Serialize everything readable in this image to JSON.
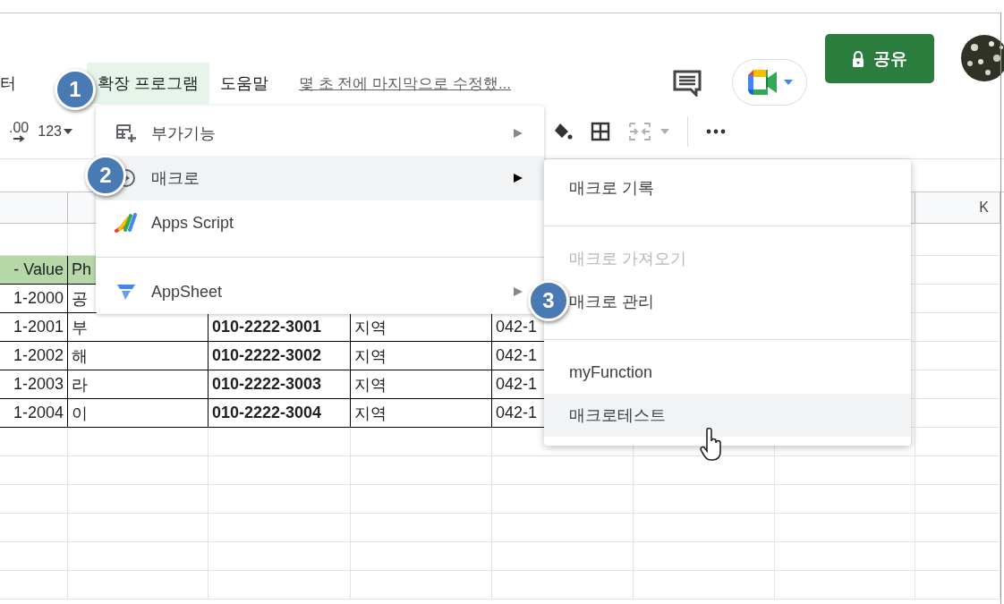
{
  "menubar": {
    "items": [
      {
        "label": "터",
        "selected": false
      },
      {
        "label": "확장 프로그램",
        "selected": true
      },
      {
        "label": "도움말",
        "selected": false
      }
    ],
    "last_edit": "몇 초 전에 마지막으로 수정했..."
  },
  "share_button": "공유",
  "toolbar": {
    "decimal": ".00",
    "format": "123",
    "merge_disabled": true
  },
  "sheet": {
    "column_header": "K",
    "header": [
      "- Value",
      "Ph"
    ],
    "rows": [
      {
        "cells": [
          "1-2000",
          "공",
          null,
          null,
          null
        ]
      },
      {
        "cells": [
          "1-2001",
          "부",
          "010-2222-3001",
          "지역",
          "042-1"
        ]
      },
      {
        "cells": [
          "1-2002",
          "해",
          "010-2222-3002",
          "지역",
          "042-1"
        ]
      },
      {
        "cells": [
          "1-2003",
          "라",
          "010-2222-3003",
          "지역",
          "042-1"
        ]
      },
      {
        "cells": [
          "1-2004",
          "이",
          "010-2222-3004",
          "지역",
          "042-1"
        ]
      }
    ]
  },
  "menu": {
    "items": [
      {
        "kind": "addon",
        "label": "부가기능",
        "selected": false,
        "submenu": true
      },
      {
        "kind": "macro",
        "label": "매크로",
        "selected": true,
        "submenu": true
      },
      {
        "kind": "script",
        "label": "Apps Script",
        "selected": false,
        "submenu": false
      },
      {
        "kind": "divider"
      },
      {
        "kind": "appsheet",
        "label": "AppSheet",
        "selected": false,
        "submenu": true
      }
    ]
  },
  "submenu": {
    "items": [
      {
        "kind": "item",
        "label": "매크로 기록",
        "selected": false,
        "disabled": false
      },
      {
        "kind": "divider"
      },
      {
        "kind": "item",
        "label": "매크로 가져오기",
        "selected": false,
        "disabled": true
      },
      {
        "kind": "item",
        "label": "매크로 관리",
        "selected": false,
        "disabled": false
      },
      {
        "kind": "divider"
      },
      {
        "kind": "item",
        "label": "myFunction",
        "selected": false,
        "disabled": false
      },
      {
        "kind": "item",
        "label": "매크로테스트",
        "selected": true,
        "disabled": false
      }
    ]
  },
  "steps": [
    "1",
    "2",
    "3"
  ]
}
